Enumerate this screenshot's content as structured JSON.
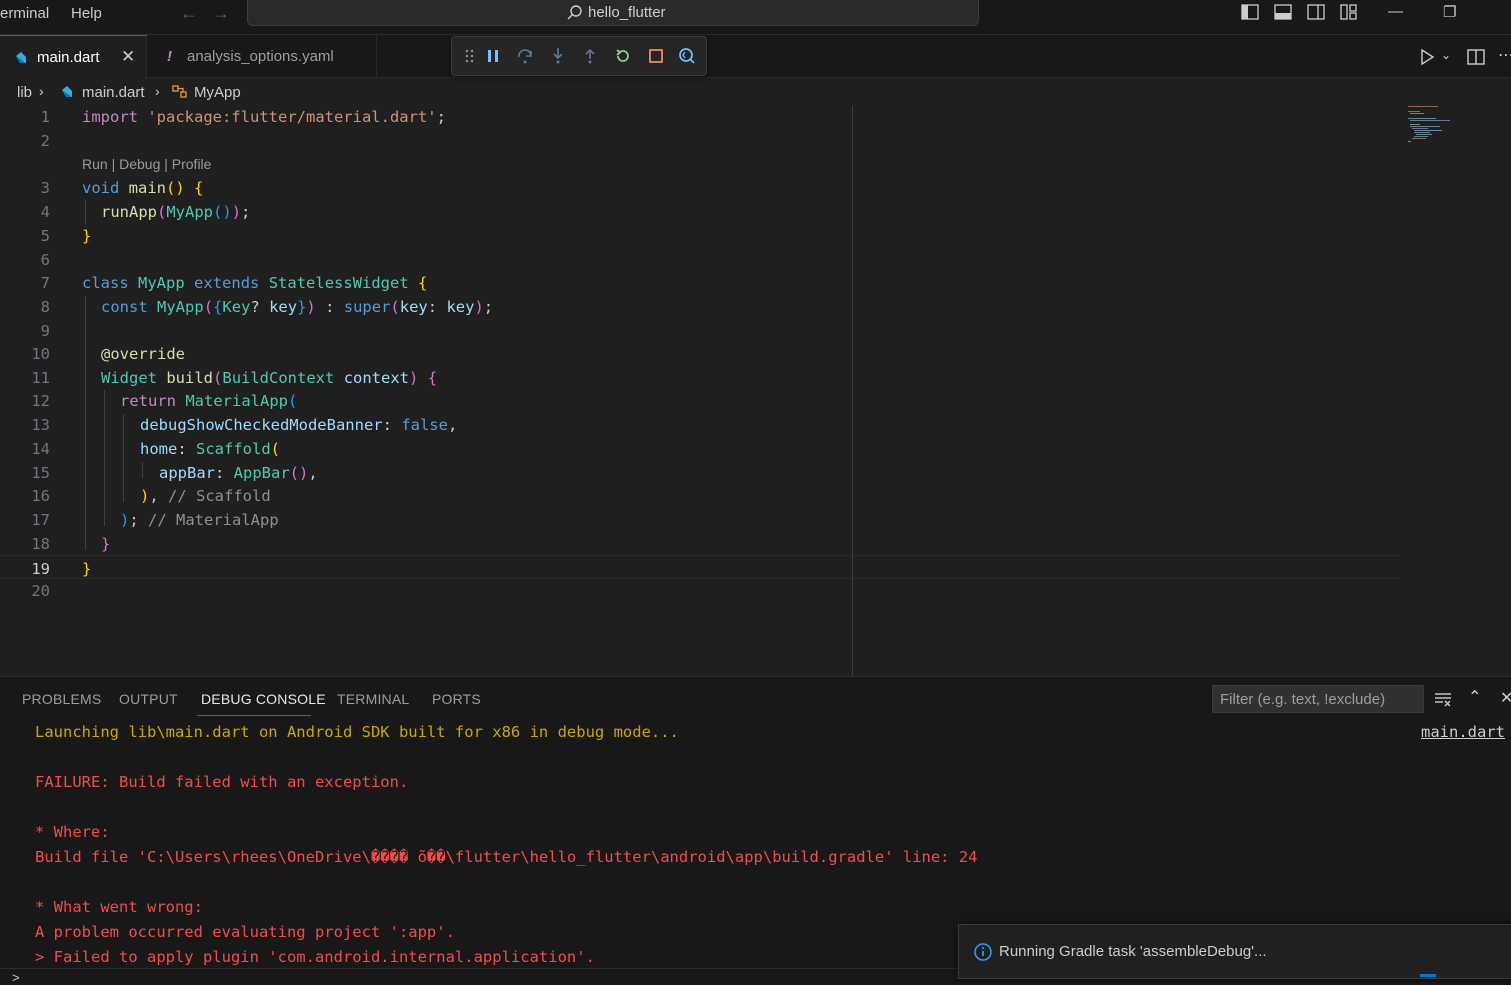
{
  "titlebar": {
    "menu": [
      "erminal",
      "Help"
    ],
    "search_text": "hello_flutter"
  },
  "tabs": [
    {
      "label": "main.dart",
      "icon": "dart-icon",
      "active": true
    },
    {
      "label": "analysis_options.yaml",
      "icon": "exclamation-icon",
      "active": false
    }
  ],
  "breadcrumb": {
    "folder": "lib",
    "file": "main.dart",
    "symbol": "MyApp"
  },
  "editor": {
    "codelens": "Run | Debug | Profile",
    "line_numbers": [
      "1",
      "2",
      "3",
      "4",
      "5",
      "6",
      "7",
      "8",
      "9",
      "10",
      "11",
      "12",
      "13",
      "14",
      "15",
      "16",
      "17",
      "18",
      "19",
      "20"
    ],
    "current_line": "19",
    "code": {
      "l1": [
        "import",
        " ",
        "'package:flutter/material.dart'",
        ";"
      ],
      "l3": [
        "void",
        " ",
        "main",
        "(",
        ")",
        " ",
        "{"
      ],
      "l4": [
        "runApp",
        "(",
        "MyApp",
        "(",
        ")",
        ")",
        ";"
      ],
      "l5": [
        "}"
      ],
      "l7": [
        "class",
        " ",
        "MyApp",
        " ",
        "extends",
        " ",
        "StatelessWidget",
        " ",
        "{"
      ],
      "l8": [
        "const",
        " ",
        "MyApp",
        "(",
        "{",
        "Key",
        "?",
        " ",
        "key",
        "}",
        ")",
        " : ",
        "super",
        "(",
        "key",
        ": ",
        "key",
        ")",
        ";"
      ],
      "l10": [
        "@override"
      ],
      "l11": [
        "Widget",
        " ",
        "build",
        "(",
        "BuildContext",
        " ",
        "context",
        ")",
        " ",
        "{"
      ],
      "l12": [
        "return",
        " ",
        "MaterialApp",
        "("
      ],
      "l13": [
        "debugShowCheckedModeBanner",
        ": ",
        "false",
        ","
      ],
      "l14": [
        "home",
        ": ",
        "Scaffold",
        "("
      ],
      "l15": [
        "appBar",
        ": ",
        "AppBar",
        "(",
        ")",
        ","
      ],
      "l16": [
        ")",
        ", ",
        "// Scaffold"
      ],
      "l17": [
        ")",
        "; ",
        "// MaterialApp"
      ],
      "l18": [
        "}"
      ],
      "l19": [
        "}"
      ]
    }
  },
  "panel": {
    "tabs": [
      "PROBLEMS",
      "OUTPUT",
      "DEBUG CONSOLE",
      "TERMINAL",
      "PORTS"
    ],
    "active_tab": "DEBUG CONSOLE",
    "filter_placeholder": "Filter (e.g. text, !exclude)",
    "source_link": "main.dart",
    "console": [
      "Launching lib\\main.dart on Android SDK built for x86 in debug mode...",
      "FAILURE: Build failed with an exception.",
      "* Where:",
      "Build file 'C:\\Users\\rhees\\OneDrive\\���� õ��\\flutter\\hello_flutter\\android\\app\\build.gradle' line: 24",
      "* What went wrong:",
      "A problem occurred evaluating project ':app'.",
      "> Failed to apply plugin 'com.android.internal.application'."
    ],
    "prompt": ">"
  },
  "toast": {
    "message": "Running Gradle task 'assembleDebug'..."
  },
  "colors": {
    "accent": "#0078d4",
    "error": "#f14c4c",
    "warning": "#cca700"
  }
}
